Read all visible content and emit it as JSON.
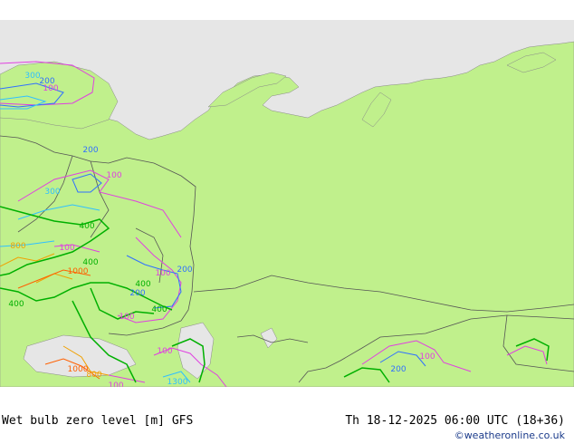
{
  "footer": {
    "product": "Wet bulb zero level [m] GFS",
    "valid_time": "Th 18-12-2025 06:00 UTC (18+36)",
    "credit": "©weatheronline.co.uk"
  },
  "colors": {
    "sea": "#e6e6e6",
    "land": "#c0f08c",
    "border": "#555555",
    "c100": "#e040e0",
    "c200": "#3070ff",
    "c300": "#30c0ff",
    "c400": "#00b000",
    "c800": "#f0a000",
    "c1000": "#ff6000"
  },
  "contour_labels": [
    {
      "text": "300",
      "color": "c300"
    },
    {
      "text": "200",
      "color": "c200"
    },
    {
      "text": "100",
      "color": "c100"
    },
    {
      "text": "200",
      "color": "c200"
    },
    {
      "text": "100",
      "color": "c100"
    },
    {
      "text": "300",
      "color": "c300"
    },
    {
      "text": "400",
      "color": "c400"
    },
    {
      "text": "800",
      "color": "c800"
    },
    {
      "text": "100",
      "color": "c100"
    },
    {
      "text": "1000",
      "color": "c1000"
    },
    {
      "text": "400",
      "color": "c400"
    },
    {
      "text": "400",
      "color": "c400"
    },
    {
      "text": "100",
      "color": "c100"
    },
    {
      "text": "200",
      "color": "c200"
    },
    {
      "text": "200",
      "color": "c200"
    },
    {
      "text": "400",
      "color": "c400"
    },
    {
      "text": "400",
      "color": "c400"
    },
    {
      "text": "100",
      "color": "c100"
    },
    {
      "text": "100",
      "color": "c100"
    },
    {
      "text": "1000",
      "color": "c1000"
    },
    {
      "text": "800",
      "color": "c800"
    },
    {
      "text": "1300",
      "color": "c300"
    },
    {
      "text": "100",
      "color": "c100"
    },
    {
      "text": "200",
      "color": "c200"
    },
    {
      "text": "100",
      "color": "c100"
    }
  ]
}
